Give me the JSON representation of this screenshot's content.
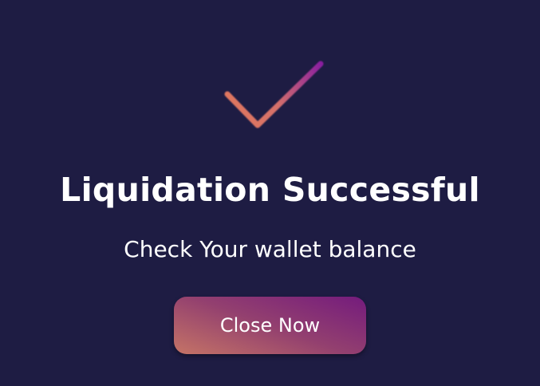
{
  "modal": {
    "icon": "checkmark-icon",
    "title": "Liquidation Successful",
    "subtitle": "Check Your wallet balance",
    "close_label": "Close Now"
  },
  "colors": {
    "background": "#1e1c43",
    "gradient_start": "#e0775f",
    "gradient_end": "#8a1fa0"
  }
}
